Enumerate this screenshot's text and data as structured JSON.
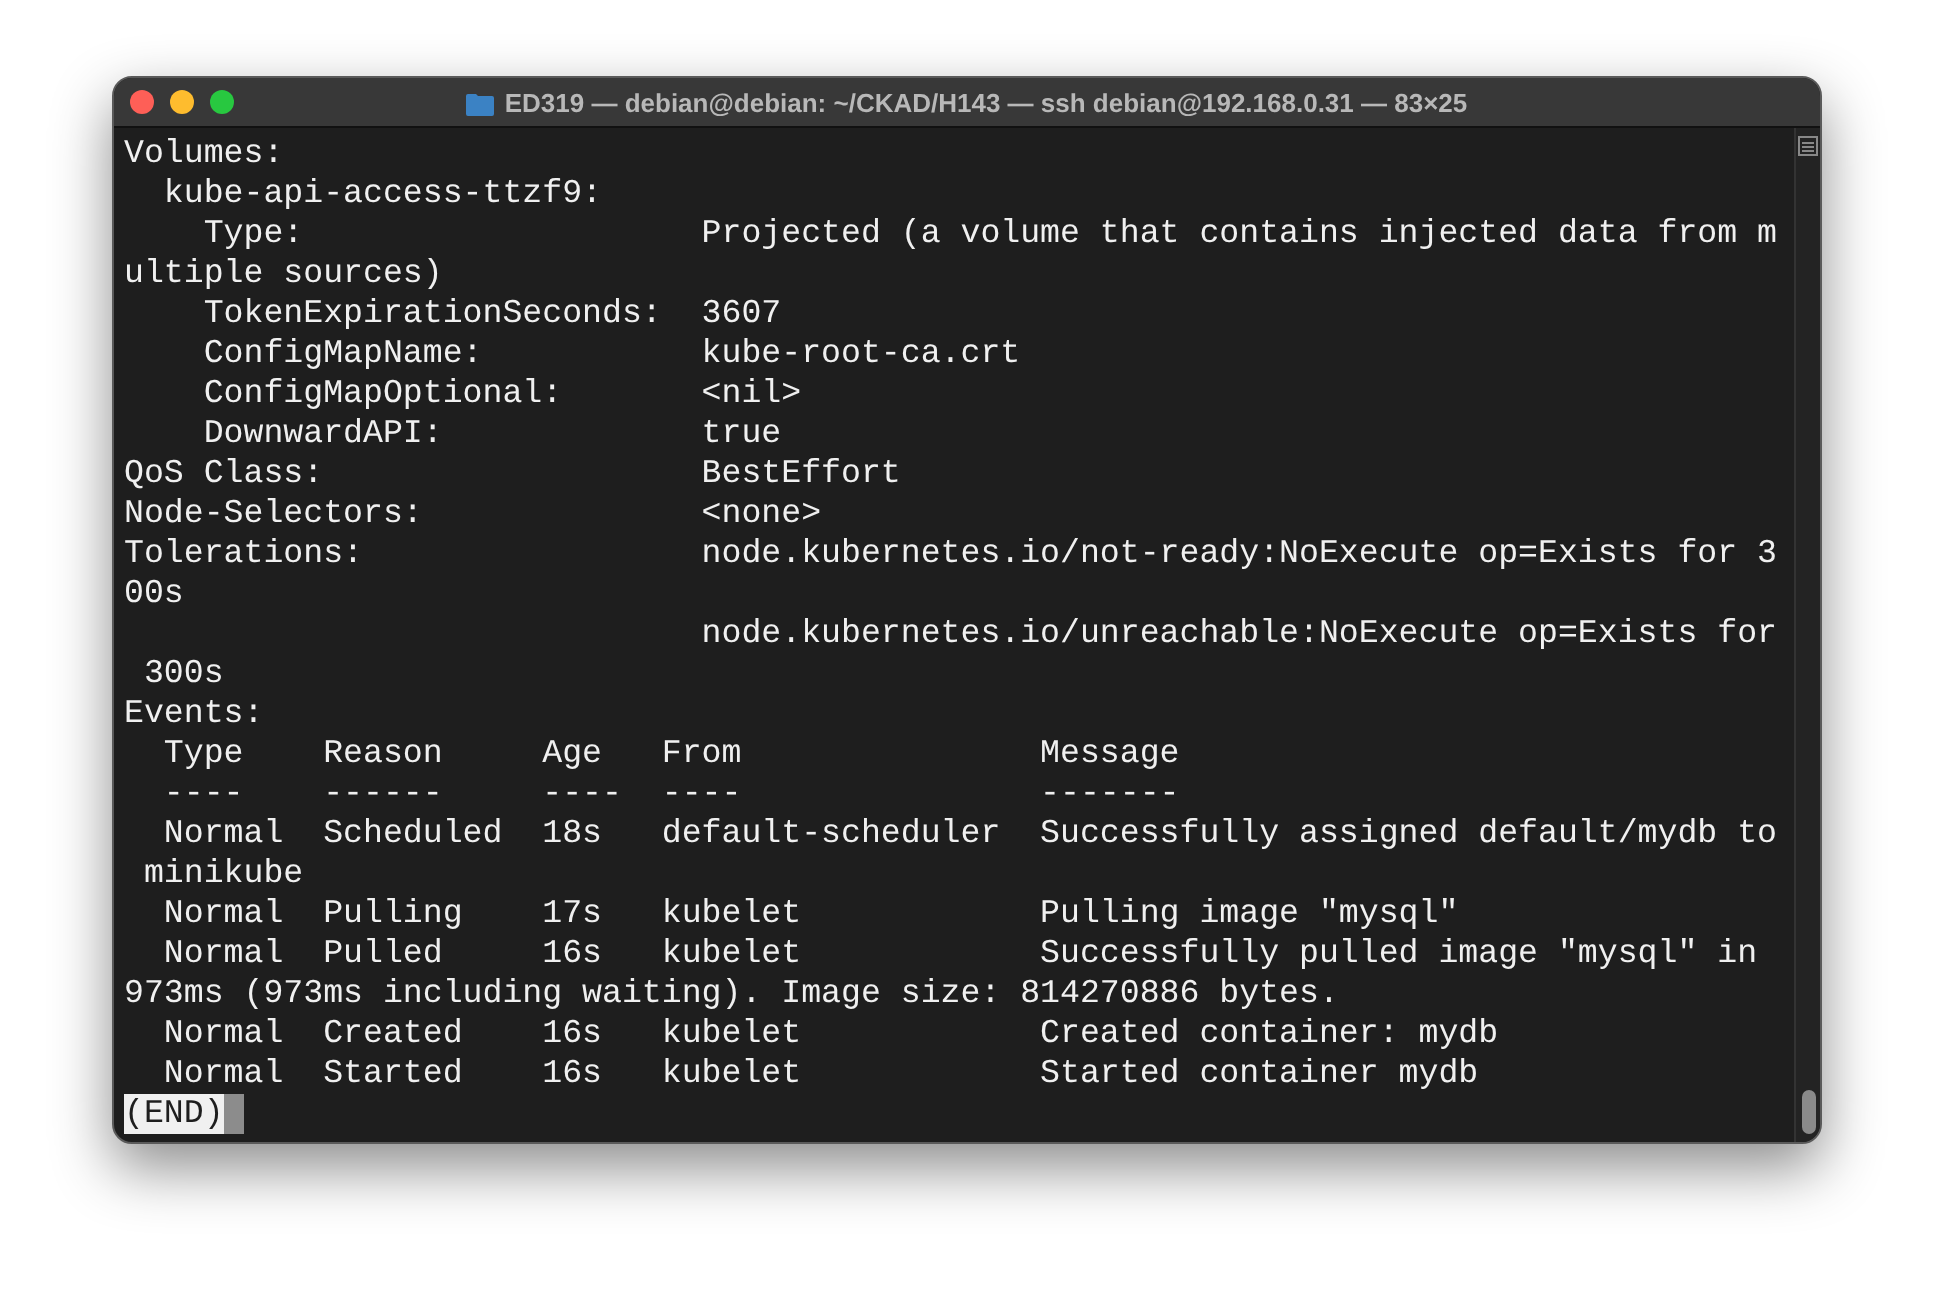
{
  "window": {
    "title": "ED319 — debian@debian: ~/CKAD/H143 — ssh debian@192.168.0.31 — 83×25"
  },
  "terminal": {
    "lines": [
      "Volumes:",
      "  kube-api-access-ttzf9:",
      "    Type:                    Projected (a volume that contains injected data from m",
      "ultiple sources)",
      "    TokenExpirationSeconds:  3607",
      "    ConfigMapName:           kube-root-ca.crt",
      "    ConfigMapOptional:       <nil>",
      "    DownwardAPI:             true",
      "QoS Class:                   BestEffort",
      "Node-Selectors:              <none>",
      "Tolerations:                 node.kubernetes.io/not-ready:NoExecute op=Exists for 3",
      "00s",
      "                             node.kubernetes.io/unreachable:NoExecute op=Exists for",
      " 300s",
      "Events:",
      "  Type    Reason     Age   From               Message",
      "  ----    ------     ----  ----               -------",
      "  Normal  Scheduled  18s   default-scheduler  Successfully assigned default/mydb to",
      " minikube",
      "  Normal  Pulling    17s   kubelet            Pulling image \"mysql\"",
      "  Normal  Pulled     16s   kubelet            Successfully pulled image \"mysql\" in",
      "973ms (973ms including waiting). Image size: 814270886 bytes.",
      "  Normal  Created    16s   kubelet            Created container: mydb",
      "  Normal  Started    16s   kubelet            Started container mydb"
    ],
    "pager_prompt": "(END)"
  }
}
